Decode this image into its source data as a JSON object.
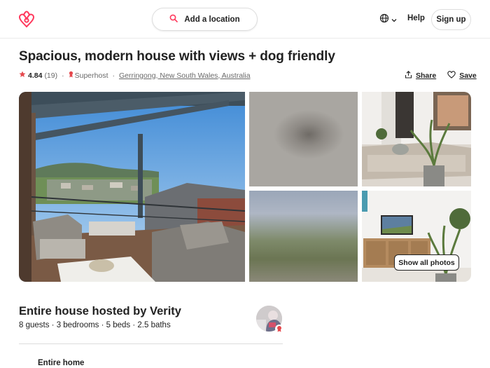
{
  "header": {
    "logo_icon": "airbnb-logo-icon",
    "search_label": "Add a location",
    "search_icon": "search-icon",
    "globe_icon": "globe-icon",
    "help_label": "Help",
    "signup_label": "Sign up",
    "brand_color": "#FF385C"
  },
  "listing": {
    "title": "Spacious, modern house with views + dog friendly",
    "rating": "4.84",
    "reviews": "(19)",
    "superhost": "Superhost",
    "location": "Gerringong, New South Wales, Australia",
    "share_label": "Share",
    "save_label": "Save"
  },
  "photos": {
    "show_all_label": "Show all photos"
  },
  "host": {
    "title": "Entire house hosted by Verity",
    "summary": "8 guests · 3 bedrooms · 5 beds · 2.5 baths"
  },
  "features": [
    {
      "title": "Entire home"
    }
  ]
}
